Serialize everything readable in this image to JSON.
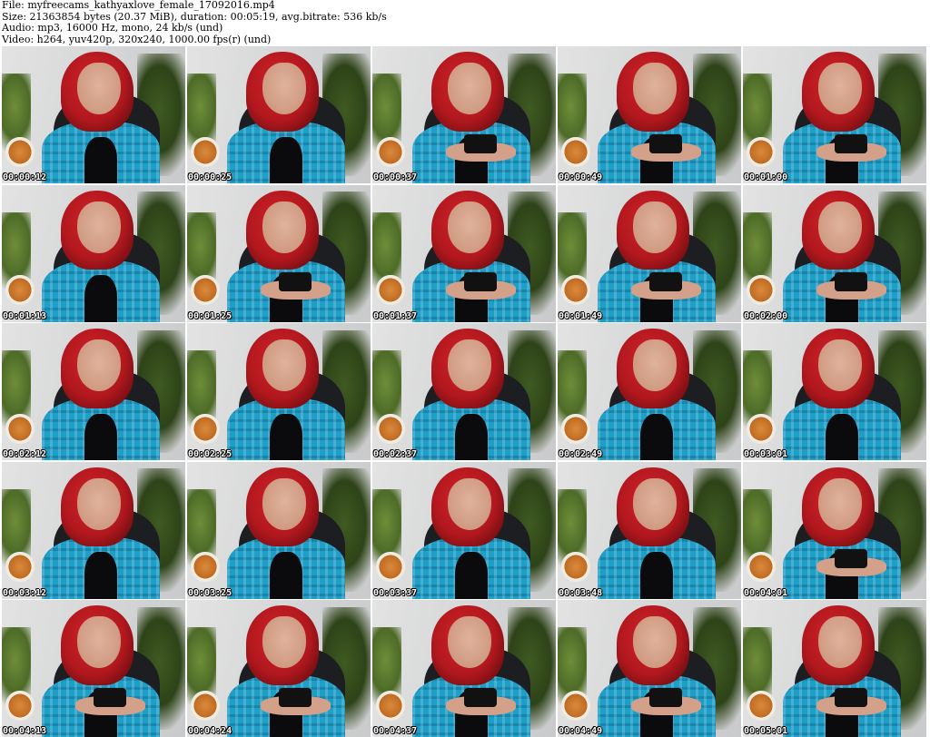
{
  "header": {
    "file": "File: myfreecams_kathyaxlove_female_17092016.mp4",
    "size": "Size: 21363854 bytes (20.37 MiB), duration: 00:05:19, avg.bitrate: 536 kb/s",
    "audio": "Audio: mp3, 16000 Hz, mono, 24 kb/s (und)",
    "video": "Video: h264, yuv420p, 320x240, 1000.00 fps(r) (und)"
  },
  "thumbnails": [
    {
      "timestamp": "00:00:12",
      "phone": false
    },
    {
      "timestamp": "00:00:25",
      "phone": false
    },
    {
      "timestamp": "00:00:37",
      "phone": true
    },
    {
      "timestamp": "00:00:49",
      "phone": true
    },
    {
      "timestamp": "00:01:00",
      "phone": true
    },
    {
      "timestamp": "00:01:13",
      "phone": false
    },
    {
      "timestamp": "00:01:25",
      "phone": true
    },
    {
      "timestamp": "00:01:37",
      "phone": true
    },
    {
      "timestamp": "00:01:49",
      "phone": true
    },
    {
      "timestamp": "00:02:00",
      "phone": true
    },
    {
      "timestamp": "00:02:12",
      "phone": false
    },
    {
      "timestamp": "00:02:25",
      "phone": false
    },
    {
      "timestamp": "00:02:37",
      "phone": false
    },
    {
      "timestamp": "00:02:49",
      "phone": false
    },
    {
      "timestamp": "00:03:01",
      "phone": false
    },
    {
      "timestamp": "00:03:12",
      "phone": false
    },
    {
      "timestamp": "00:03:25",
      "phone": false
    },
    {
      "timestamp": "00:03:37",
      "phone": false
    },
    {
      "timestamp": "00:03:48",
      "phone": false
    },
    {
      "timestamp": "00:04:01",
      "phone": true
    },
    {
      "timestamp": "00:04:13",
      "phone": true
    },
    {
      "timestamp": "00:04:24",
      "phone": true
    },
    {
      "timestamp": "00:04:37",
      "phone": true
    },
    {
      "timestamp": "00:04:49",
      "phone": true
    },
    {
      "timestamp": "00:05:01",
      "phone": true
    }
  ]
}
